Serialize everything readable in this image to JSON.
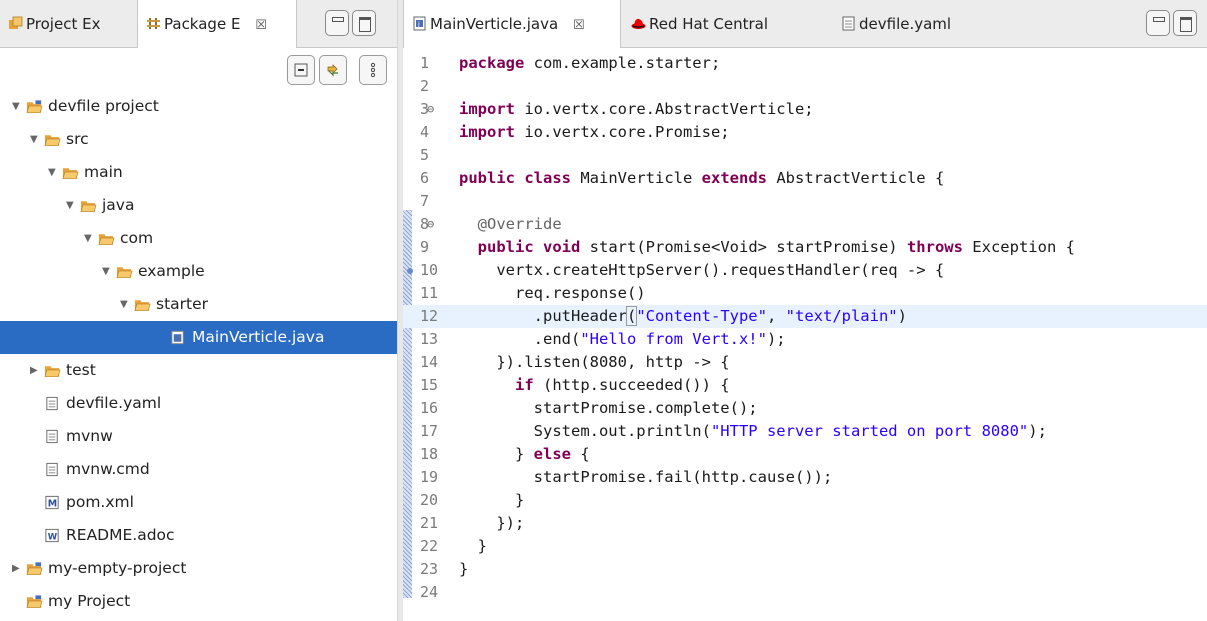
{
  "left_tabs": [
    {
      "label": "Project Ex"
    },
    {
      "label": "Package E",
      "close": "☒"
    }
  ],
  "tree": [
    {
      "label": "devfile project",
      "type": "project",
      "expanded": true
    },
    {
      "label": "src",
      "type": "folder",
      "expanded": true
    },
    {
      "label": "main",
      "type": "folder",
      "expanded": true
    },
    {
      "label": "java",
      "type": "folder",
      "expanded": true
    },
    {
      "label": "com",
      "type": "folder",
      "expanded": true
    },
    {
      "label": "example",
      "type": "folder",
      "expanded": true
    },
    {
      "label": "starter",
      "type": "folder",
      "expanded": true
    },
    {
      "label": "MainVerticle.java",
      "type": "java",
      "selected": true
    },
    {
      "label": "test",
      "type": "folder",
      "expanded": false
    },
    {
      "label": "devfile.yaml",
      "type": "file"
    },
    {
      "label": "mvnw",
      "type": "file"
    },
    {
      "label": "mvnw.cmd",
      "type": "file"
    },
    {
      "label": "pom.xml",
      "type": "maven"
    },
    {
      "label": "README.adoc",
      "type": "adoc"
    },
    {
      "label": "my-empty-project",
      "type": "project",
      "expanded": false
    },
    {
      "label": "my Project",
      "type": "project"
    }
  ],
  "editor_tabs": [
    {
      "label": "MainVerticle.java",
      "close": "☒",
      "icon": "java-file-icon"
    },
    {
      "label": "Red Hat Central",
      "icon": "red-hat-icon"
    },
    {
      "label": "devfile.yaml",
      "icon": "text-file-icon"
    }
  ],
  "code": {
    "lines": [
      "1|package com.example.starter;",
      "2|",
      "3|import io.vertx.core.AbstractVerticle;",
      "4|import io.vertx.core.Promise;",
      "5|",
      "6|public class MainVerticle extends AbstractVerticle {",
      "7|",
      "8|  @Override",
      "9|  public void start(Promise<Void> startPromise) throws Exception {",
      "10|    vertx.createHttpServer().requestHandler(req -> {",
      "11|      req.response()",
      "12|        .putHeader(\"Content-Type\", \"text/plain\")",
      "13|        .end(\"Hello from Vert.x!\");",
      "14|    }).listen(8080, http -> {",
      "15|      if (http.succeeded()) {",
      "16|        startPromise.complete();",
      "17|        System.out.println(\"HTTP server started on port 8080\");",
      "18|      } else {",
      "19|        startPromise.fail(http.cause());",
      "20|      }",
      "21|    });",
      "22|  }",
      "23|}",
      "24|"
    ],
    "highlight_line": 12,
    "fold_lines": [
      3,
      8
    ]
  },
  "colors": {
    "selection": "#2a6bc4",
    "keyword": "#7f0055",
    "string": "#2a00ff",
    "folder": "#e8a23a"
  }
}
